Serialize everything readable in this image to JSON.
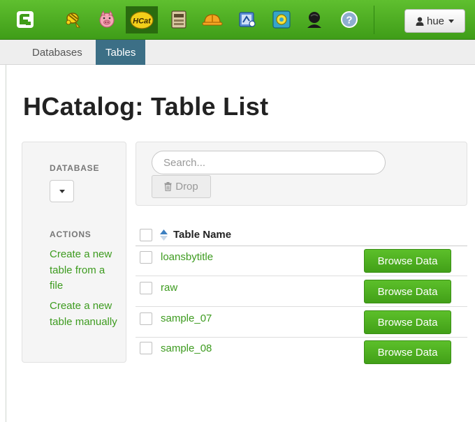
{
  "topbar": {
    "apps": [
      {
        "icon": "hue-logo-icon"
      },
      {
        "icon": "beeswax-hive-icon"
      },
      {
        "icon": "pig-icon"
      },
      {
        "icon": "hcatalog-icon",
        "label": "HCat",
        "active": true
      },
      {
        "icon": "file-browser-icon"
      },
      {
        "icon": "job-designer-icon"
      },
      {
        "icon": "oozie-icon"
      },
      {
        "icon": "job-browser-icon"
      },
      {
        "icon": "user-admin-icon"
      },
      {
        "icon": "help-icon"
      }
    ],
    "user": {
      "label": "hue"
    }
  },
  "subnav": {
    "tabs": [
      {
        "label": "Databases",
        "active": false
      },
      {
        "label": "Tables",
        "active": true
      }
    ]
  },
  "page": {
    "title": "HCatalog: Table List"
  },
  "sidebar": {
    "database_heading": "DATABASE",
    "database_selected": "",
    "actions_heading": "ACTIONS",
    "actions": [
      {
        "label": "Create a new table from a file"
      },
      {
        "label": "Create a new table manually"
      }
    ]
  },
  "search": {
    "placeholder": "Search...",
    "value": ""
  },
  "drop_button": {
    "label": "Drop",
    "icon": "trash-icon",
    "enabled": false
  },
  "table": {
    "column_header": "Table Name",
    "sort": "ascending",
    "rows": [
      {
        "name": "loansbytitle",
        "action": "Browse Data"
      },
      {
        "name": "raw",
        "action": "Browse Data"
      },
      {
        "name": "sample_07",
        "action": "Browse Data"
      },
      {
        "name": "sample_08",
        "action": "Browse Data"
      }
    ]
  },
  "colors": {
    "topbar": "#4fae22",
    "active_app": "#2a6b0f",
    "active_tab": "#3c6f86",
    "link": "#3d9b1f",
    "button": "#4fb321"
  }
}
